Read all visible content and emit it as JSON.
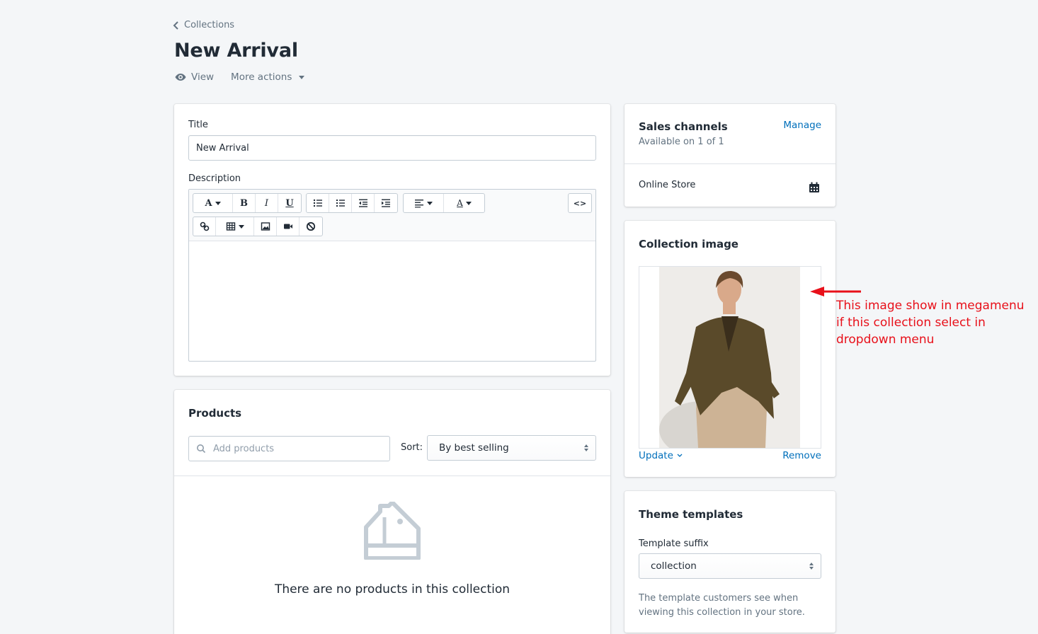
{
  "breadcrumb": {
    "label": "Collections"
  },
  "page": {
    "title": "New Arrival"
  },
  "header_actions": {
    "view": "View",
    "more_actions": "More actions"
  },
  "details": {
    "title_label": "Title",
    "title_value": "New Arrival",
    "description_label": "Description",
    "toolbar": {
      "font_letter": "A",
      "bold": "B",
      "italic": "I",
      "underline": "U",
      "color_letter": "A",
      "code": "<>"
    }
  },
  "products": {
    "heading": "Products",
    "search_placeholder": "Add products",
    "sort_label": "Sort:",
    "sort_value": "By best selling",
    "empty_message": "There are no products in this collection"
  },
  "sales_channels": {
    "heading": "Sales channels",
    "manage": "Manage",
    "availability": "Available on 1 of 1",
    "channel": "Online Store"
  },
  "collection_image": {
    "heading": "Collection image",
    "update": "Update",
    "remove": "Remove"
  },
  "annotation": {
    "lines": [
      "This image show in megamenu",
      "if this collection select in",
      "dropdown menu"
    ],
    "color": "#e8101a"
  },
  "theme_templates": {
    "heading": "Theme templates",
    "suffix_label": "Template suffix",
    "suffix_value": "collection",
    "help_line1": "The template customers see when",
    "help_line2": "viewing this collection in your store."
  },
  "colors": {
    "link": "#006fbb",
    "background": "#f4f6f8",
    "muted": "#637381"
  }
}
